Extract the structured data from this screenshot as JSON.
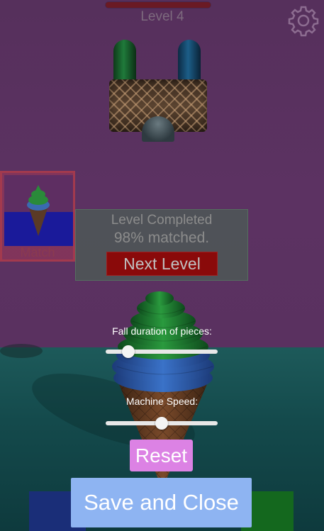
{
  "hud": {
    "level_label": "Level 4",
    "level_progress": 1.0
  },
  "match_preview": {
    "label": "Match"
  },
  "level_completed": {
    "title": "Level Completed",
    "match_text": "98% matched.",
    "next_button": "Next Level"
  },
  "settings": {
    "fall_duration_label": "Fall duration of pieces:",
    "fall_duration_value": 0.2,
    "machine_speed_label": "Machine Speed:",
    "machine_speed_value": 0.5,
    "reset_button": "Reset",
    "save_button": "Save and Close"
  },
  "icons": {
    "settings": "gear-icon"
  },
  "colors": {
    "reset_button": "#dc82e4",
    "save_button": "#8eb4f2",
    "next_button": "#8a0a0a",
    "cream_top": "#1f7a2e",
    "cream_bottom": "#2a5aa0",
    "cone": "#6a3a1e"
  }
}
